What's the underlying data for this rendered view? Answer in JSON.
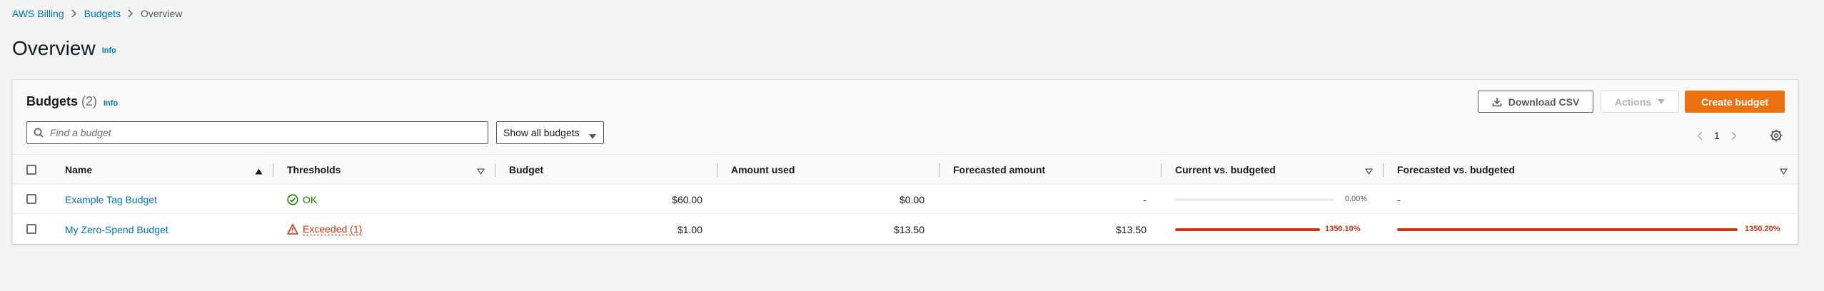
{
  "breadcrumb": {
    "items": [
      "AWS Billing",
      "Budgets"
    ],
    "current": "Overview"
  },
  "page": {
    "title": "Overview",
    "info": "Info"
  },
  "container": {
    "title": "Budgets",
    "count": "(2)",
    "info": "Info",
    "download_label": "Download CSV",
    "actions_label": "Actions",
    "create_label": "Create budget",
    "search_placeholder": "Find a budget",
    "filter_value": "Show all budgets",
    "page_number": "1"
  },
  "table": {
    "columns": {
      "name": "Name",
      "thresholds": "Thresholds",
      "budget": "Budget",
      "amount_used": "Amount used",
      "forecasted_amount": "Forecasted amount",
      "current_vs_budgeted": "Current vs. budgeted",
      "forecasted_vs_budgeted": "Forecasted vs. budgeted"
    },
    "rows": [
      {
        "name": "Example Tag Budget",
        "threshold": "OK",
        "threshold_status": "ok",
        "budget": "$60.00",
        "amount_used": "$0.00",
        "forecasted_amount": "-",
        "current_pct": "0.00%",
        "current_fill": 0,
        "forecasted_pct": "-"
      },
      {
        "name": "My Zero-Spend Budget",
        "threshold": "Exceeded (1)",
        "threshold_status": "exceeded",
        "budget": "$1.00",
        "amount_used": "$13.50",
        "forecasted_amount": "$13.50",
        "current_pct": "1350.10%",
        "current_fill": 1,
        "forecasted_pct": "1350.20%",
        "forecasted_fill": 1
      }
    ]
  },
  "colors": {
    "link": "#0073bb",
    "primary": "#ec7211",
    "success": "#1d8102",
    "error": "#d13212"
  }
}
